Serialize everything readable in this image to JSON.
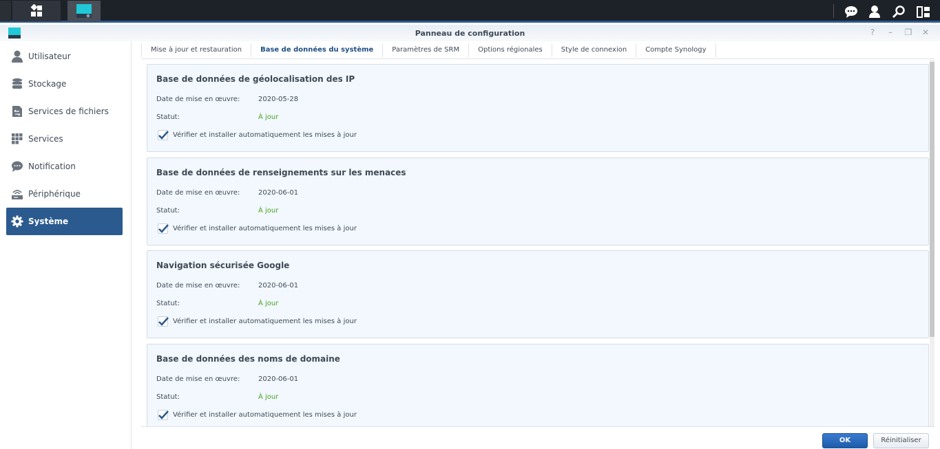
{
  "window": {
    "title": "Panneau de configuration"
  },
  "window_controls": {
    "help": "?",
    "minimize": "–",
    "restore": "❐",
    "close": "✕"
  },
  "taskbar": {
    "icons": [
      "main-menu-icon",
      "control-panel-icon",
      "chat-icon",
      "user-icon",
      "search-icon",
      "widgets-icon"
    ]
  },
  "sidebar": {
    "items": [
      {
        "label": "Utilisateur",
        "icon": "user-icon"
      },
      {
        "label": "Stockage",
        "icon": "database-icon"
      },
      {
        "label": "Services de fichiers",
        "icon": "file-services-icon"
      },
      {
        "label": "Services",
        "icon": "grid-icon"
      },
      {
        "label": "Notification",
        "icon": "chat-icon"
      },
      {
        "label": "Périphérique",
        "icon": "router-icon"
      },
      {
        "label": "Système",
        "icon": "gear-icon",
        "active": true
      }
    ]
  },
  "tabs": [
    {
      "label": "Mise à jour et restauration"
    },
    {
      "label": "Base de données du système",
      "active": true
    },
    {
      "label": "Paramètres de SRM"
    },
    {
      "label": "Options régionales"
    },
    {
      "label": "Style de connexion"
    },
    {
      "label": "Compte Synology"
    }
  ],
  "cards": [
    {
      "title": "Base de données de géolocalisation des IP",
      "date_label": "Date de mise en œuvre:",
      "date": "2020-05-28",
      "status_label": "Statut:",
      "status": "À jour",
      "auto_label": "Vérifier et installer automatiquement les mises à jour",
      "auto_checked": true
    },
    {
      "title": "Base de données de renseignements sur les menaces",
      "date_label": "Date de mise en œuvre:",
      "date": "2020-06-01",
      "status_label": "Statut:",
      "status": "À jour",
      "auto_label": "Vérifier et installer automatiquement les mises à jour",
      "auto_checked": true
    },
    {
      "title": "Navigation sécurisée Google",
      "date_label": "Date de mise en œuvre:",
      "date": "2020-06-01",
      "status_label": "Statut:",
      "status": "À jour",
      "auto_label": "Vérifier et installer automatiquement les mises à jour",
      "auto_checked": true
    },
    {
      "title": "Base de données des noms de domaine",
      "date_label": "Date de mise en œuvre:",
      "date": "2020-06-01",
      "status_label": "Statut:",
      "status": "À jour",
      "auto_label": "Vérifier et installer automatiquement les mises à jour",
      "auto_checked": true
    }
  ],
  "footer": {
    "ok_label": "OK",
    "reset_label": "Réinitialiser"
  },
  "colors": {
    "accent": "#2b5a8f",
    "status_ok": "#47a321",
    "primary_button": "#2a6bc0"
  }
}
